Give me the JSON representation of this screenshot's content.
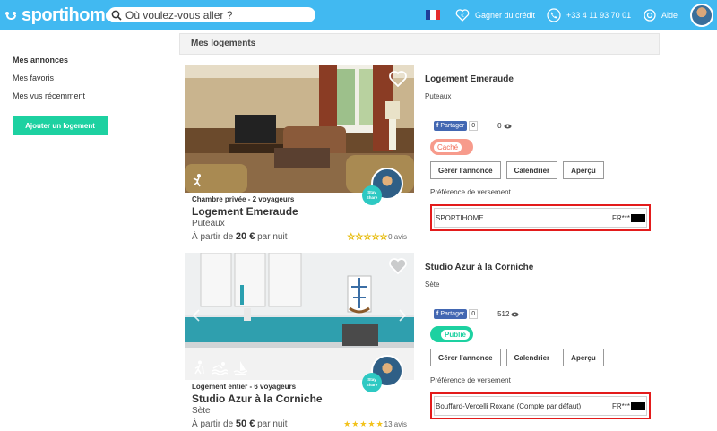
{
  "header": {
    "brand": "sportihome",
    "search_placeholder": "Où voulez-vous aller ?",
    "credit_label": "Gagner du crédit",
    "phone": "+33 4 11 93 70 01",
    "help_label": "Aide",
    "accent_color": "#41b9f1"
  },
  "sidebar": {
    "items": [
      {
        "label": "Mes annonces",
        "active": true
      },
      {
        "label": "Mes favoris",
        "active": false
      },
      {
        "label": "Mes vus récemment",
        "active": false
      }
    ],
    "add_button": "Ajouter un logement"
  },
  "main": {
    "section_title": "Mes logements",
    "listings": [
      {
        "type": "Chambre privée - 2 voyageurs",
        "title": "Logement Emeraude",
        "city": "Puteaux",
        "price_prefix": "À partir de",
        "price": "20 €",
        "price_suffix": "par nuit",
        "rating_stars": 0,
        "reviews": "0 avis",
        "badge": "Stay Share",
        "detail": {
          "title": "Logement Emeraude",
          "city": "Puteaux",
          "share_label": "Partager",
          "share_count": "0",
          "views": "0",
          "status": "Caché",
          "buttons": [
            "Gérer l'annonce",
            "Calendrier",
            "Aperçu"
          ],
          "payout_label": "Préférence de versement",
          "payout_name": "SPORTIHOME",
          "payout_account": "FR***"
        }
      },
      {
        "type": "Logement entier - 6 voyageurs",
        "title": "Studio Azur à la Corniche",
        "city": "Sète",
        "price_prefix": "À partir de",
        "price": "50 €",
        "price_suffix": "par nuit",
        "rating_stars": 5,
        "reviews": "13 avis",
        "badge": "Stay Share",
        "detail": {
          "title": "Studio Azur à la Corniche",
          "city": "Sète",
          "share_label": "Partager",
          "share_count": "0",
          "views": "512",
          "status": "Publié",
          "buttons": [
            "Gérer l'annonce",
            "Calendrier",
            "Aperçu"
          ],
          "payout_label": "Préférence de versement",
          "payout_name": "Bouffard-Vercelli Roxane (Compte par défaut)",
          "payout_account": "FR***"
        }
      }
    ]
  }
}
